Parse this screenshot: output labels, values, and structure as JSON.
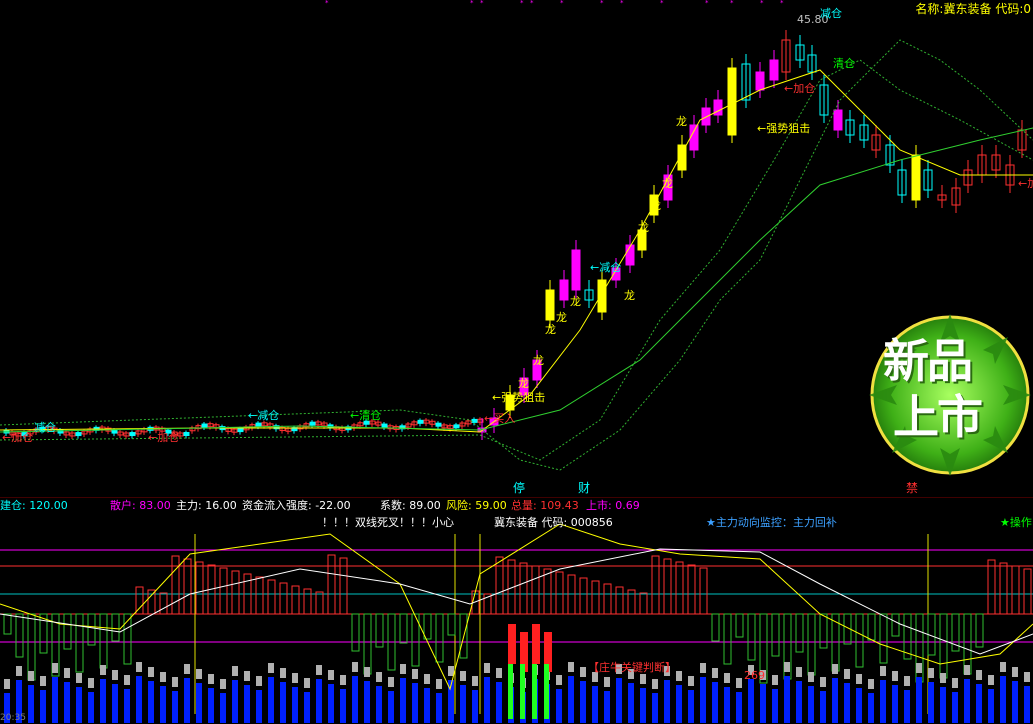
{
  "header": {
    "name_label": "名称:",
    "stock_name": "冀东装备",
    "code_label": "代码:",
    "code": "0"
  },
  "price_marker": "45.80",
  "annotations": {
    "jiancang_top": "减仓",
    "qingcang_top": "清仓",
    "jiacang": "←加仓",
    "qiangshi_1": "←强势狙击",
    "qiangshi_2": "←强势狙击",
    "maijin": "←买入",
    "jiancang_mid": "←减仓",
    "jiancang_left": "←减仓",
    "qingcang_left": "←清仓",
    "jiancang_far": "减仓",
    "jiacang_left": "←加仓",
    "long": "龙",
    "ting": "停",
    "cai": "财",
    "red_mark": "禁"
  },
  "badge": {
    "line1": "新品",
    "line2": "上市"
  },
  "info_bar": {
    "jiancang": "建仓: 120.00",
    "sanhu": "散户: 83.00",
    "zhuli": "主力: 16.00",
    "zijin": "资金流入强度: -22.00",
    "xishu": "系数: 89.00",
    "fengxian": "风险: 59.00",
    "zongliang": "总量: 109.43",
    "shangshi": "上市: 0.69"
  },
  "sub_header": {
    "warning": "！！！双线死叉！！！小心",
    "stock": "冀东装备 代码: 000856",
    "monitor": "★主力动向监控：主力回补",
    "right": "★操作"
  },
  "sub_annotations": {
    "judge": "【庄牛关键判断】",
    "value": "269"
  },
  "bottom_time": "20:35",
  "colors": {
    "up": "#ff3030",
    "down": "#00ffff",
    "yellow": "#ffff00",
    "magenta": "#ff00ff",
    "green": "#00ff00",
    "blue": "#0020ff"
  }
}
